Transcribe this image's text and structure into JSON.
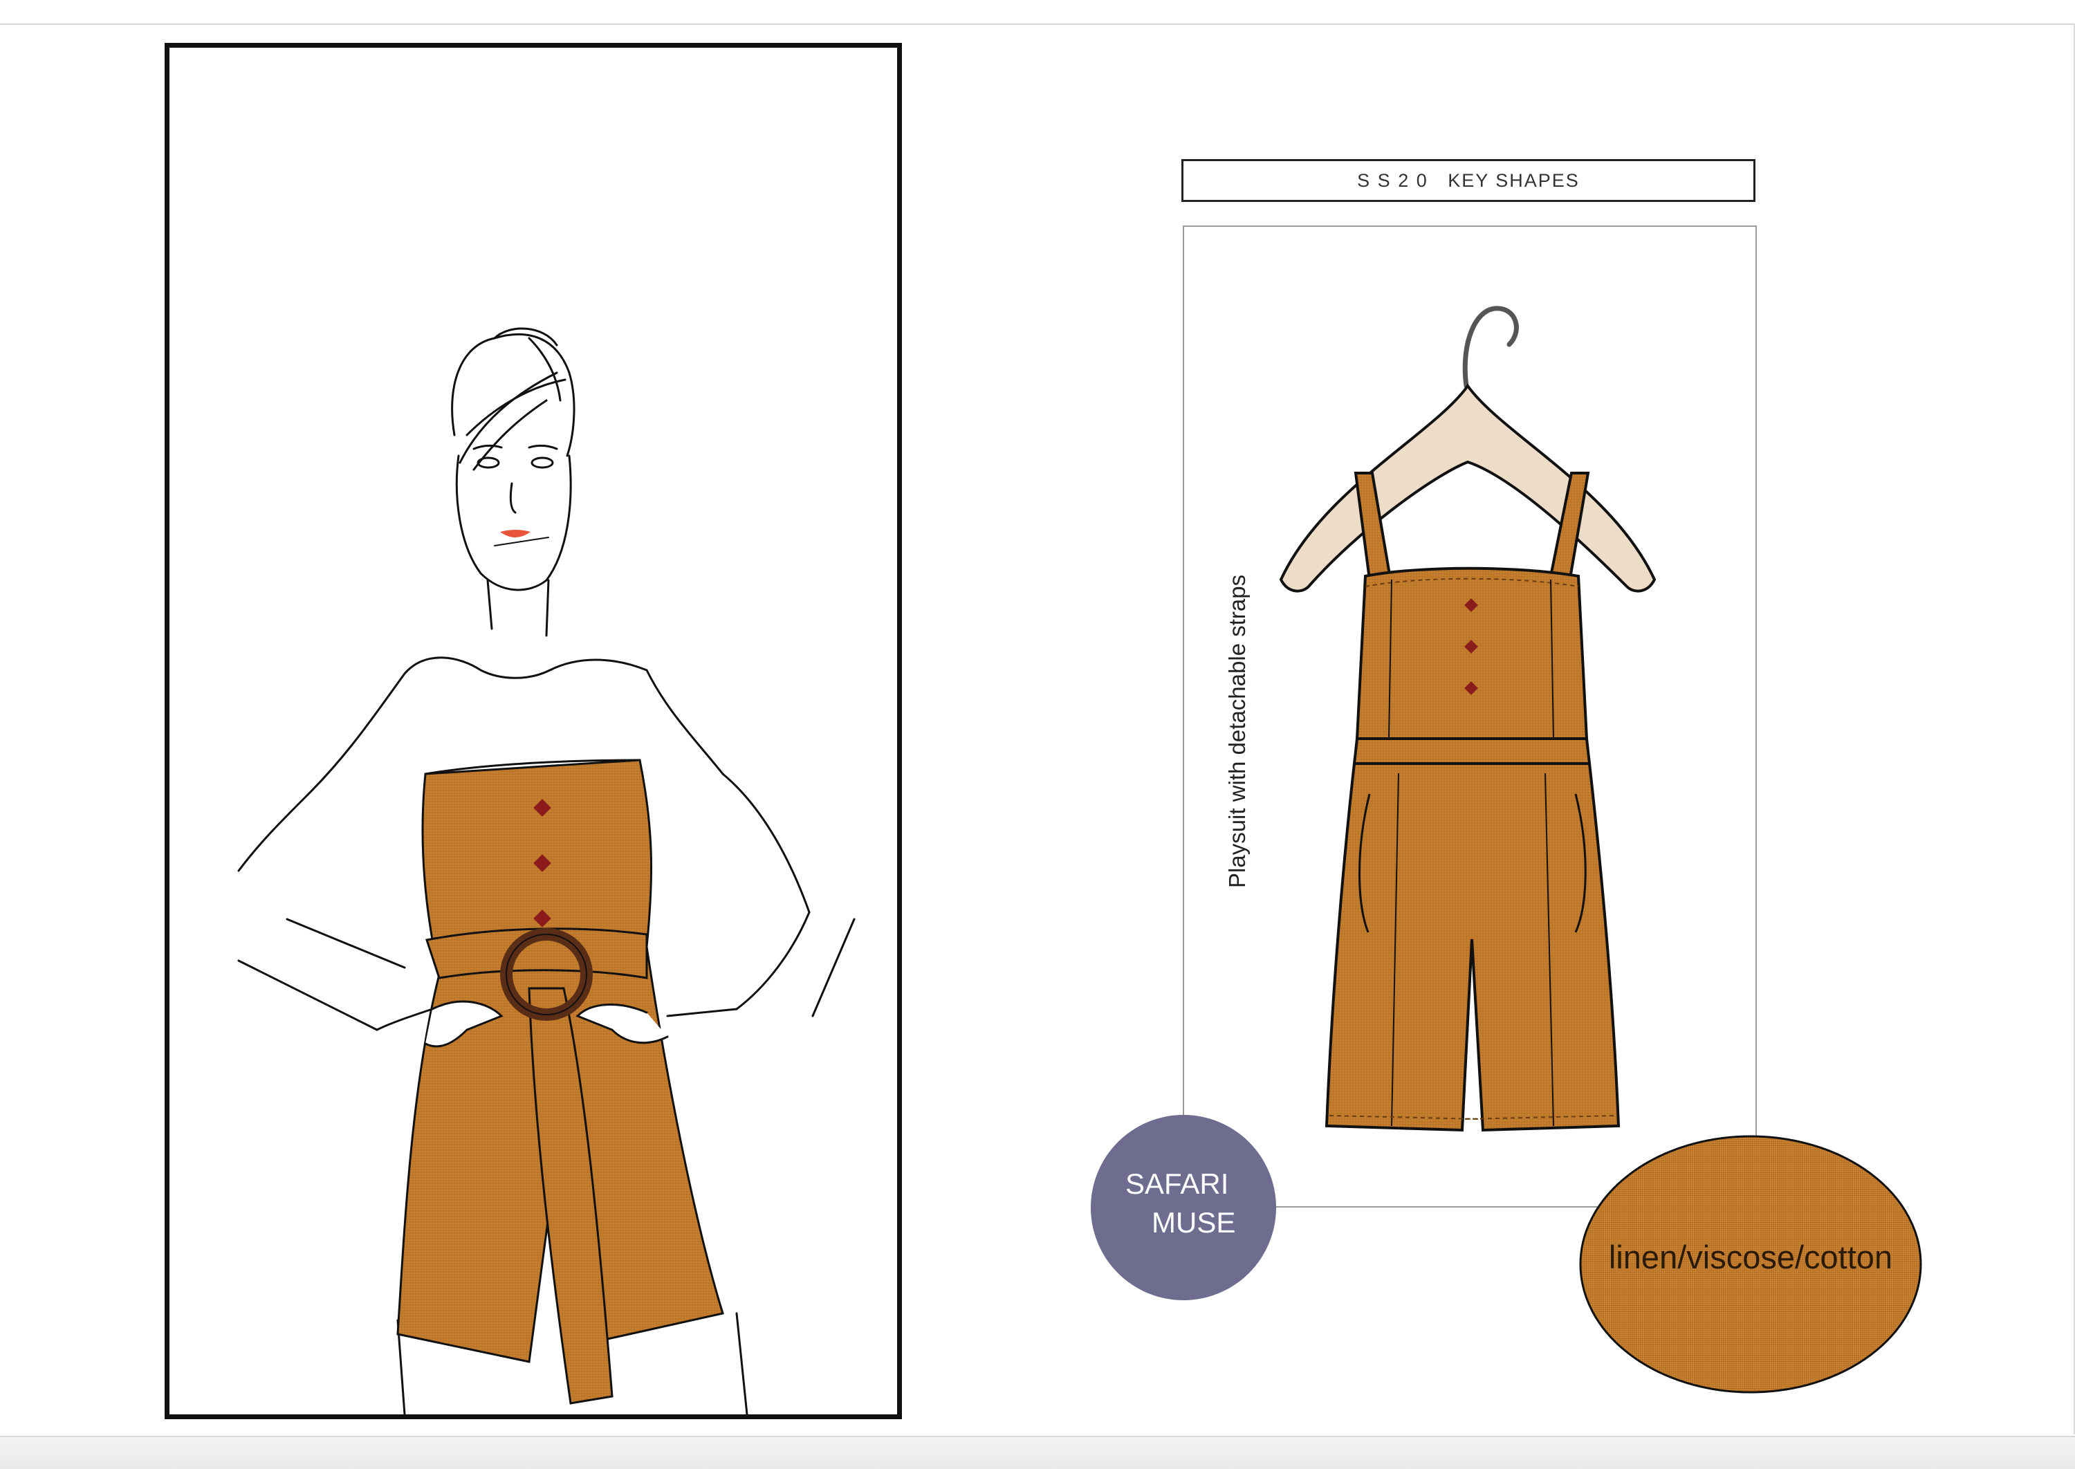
{
  "board": {
    "title": "S S 2 0   KEY SHAPES",
    "garment_caption": "Playsuit with detachable straps",
    "theme_badge": {
      "line1": "SAFARI",
      "line2": "MUSE",
      "color": "#6e6c8f"
    },
    "fabric_label": "linen/viscose/cotton"
  },
  "colors": {
    "fabric": "#c27a2b",
    "fabric_dark": "#9c5a1a",
    "buttons": "#8a1c1c",
    "belt_ring": "#5a2e16",
    "hanger_wood": "#ecdcc8",
    "lips": "#e8553c"
  },
  "icons": [
    "hanger-icon"
  ]
}
